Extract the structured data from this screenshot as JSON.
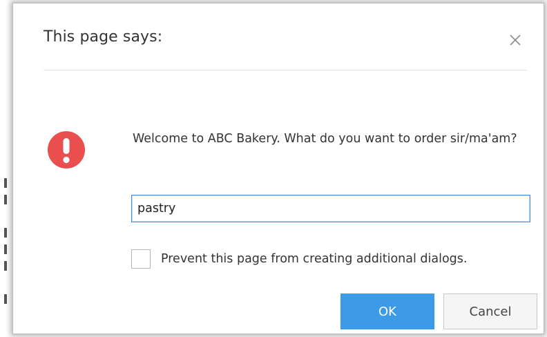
{
  "dialog": {
    "title": "This page says:",
    "message": "Welcome to ABC Bakery. What do you want to order sir/ma'am?",
    "input_value": "pastry",
    "checkbox_label": "Prevent this page from creating additional dialogs.",
    "checkbox_checked": false,
    "ok_label": "OK",
    "cancel_label": "Cancel",
    "close_icon": "close-icon",
    "alert_icon": "exclamation-circle-icon"
  },
  "colors": {
    "accent": "#3d9ae8",
    "alert": "#e94f4f",
    "input_focus_border": "#4a90d9"
  }
}
